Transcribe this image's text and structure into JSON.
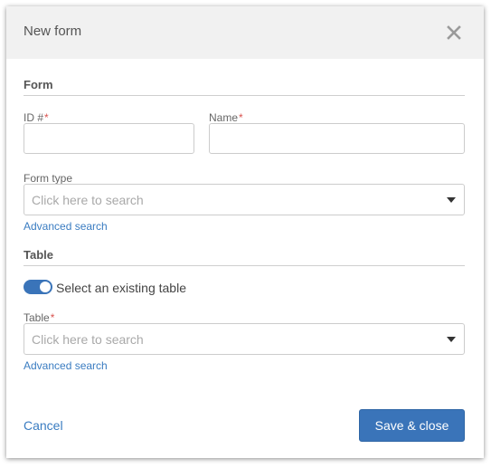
{
  "dialog": {
    "title": "New form",
    "close_icon": "close-icon"
  },
  "form_section": {
    "title": "Form",
    "id_field": {
      "label": "ID #",
      "required_mark": "*",
      "value": "",
      "placeholder": ""
    },
    "name_field": {
      "label": "Name",
      "required_mark": "*",
      "value": "",
      "placeholder": ""
    },
    "form_type": {
      "label": "Form type",
      "placeholder": "Click here to search",
      "value": "",
      "advanced_search": "Advanced search"
    }
  },
  "table_section": {
    "title": "Table",
    "toggle": {
      "label": "Select an existing table",
      "on": true,
      "color": "#3a74b9"
    },
    "table_field": {
      "label": "Table",
      "required_mark": "*",
      "placeholder": "Click here to search",
      "value": "",
      "advanced_search": "Advanced search"
    }
  },
  "footer": {
    "cancel_label": "Cancel",
    "save_label": "Save & close"
  },
  "colors": {
    "primary": "#3a74b9",
    "link": "#3a7cc1",
    "required": "#d9534f"
  }
}
